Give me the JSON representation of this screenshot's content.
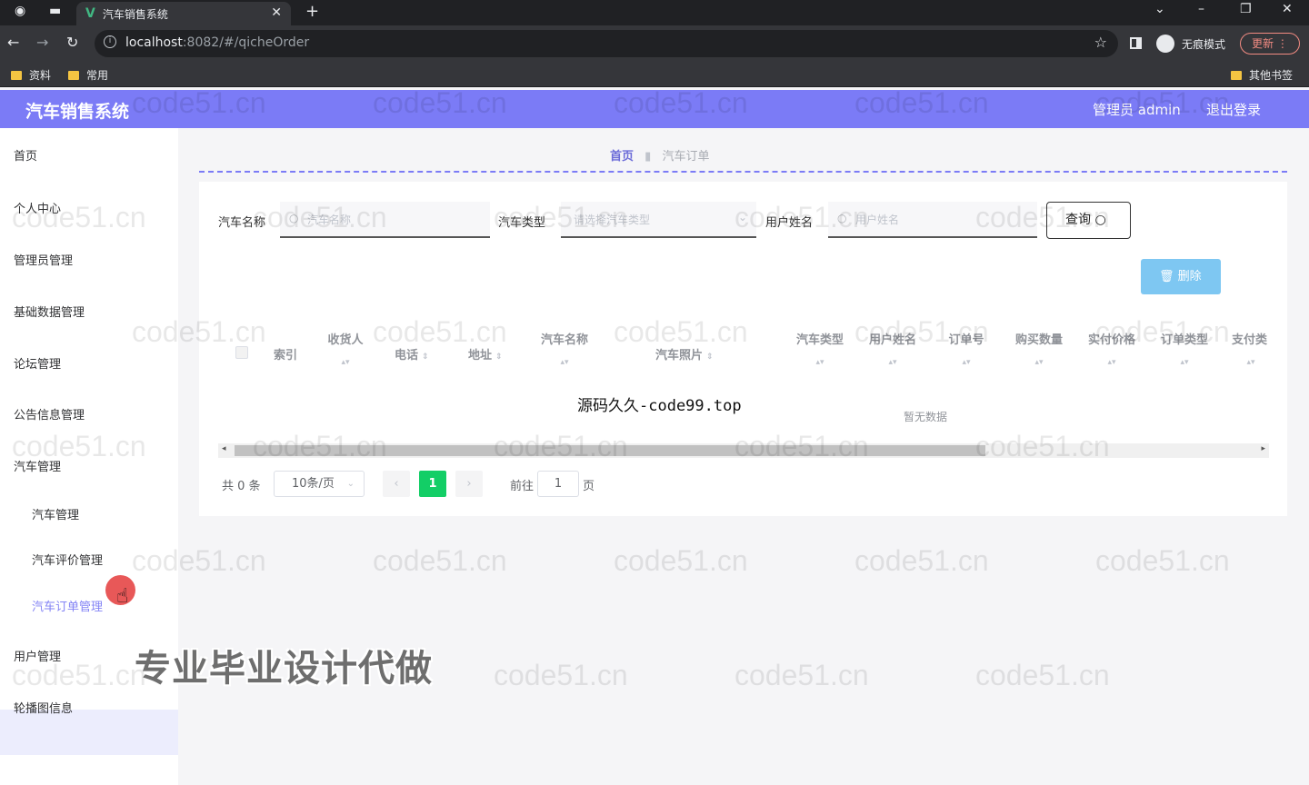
{
  "browser": {
    "tab_title": "汽车销售系统",
    "url_host": "localhost",
    "url_rest": ":8082/#/qicheOrder",
    "incognito_label": "无痕模式",
    "update_label": "更新",
    "bookmarks": [
      "资料",
      "常用"
    ],
    "other_bookmarks": "其他书签"
  },
  "header": {
    "title": "汽车销售系统",
    "admin_label": "管理员 admin",
    "logout_label": "退出登录"
  },
  "sidebar": {
    "items": [
      "首页",
      "个人中心",
      "管理员管理",
      "基础数据管理",
      "论坛管理",
      "公告信息管理",
      "汽车管理"
    ],
    "sub_items": [
      "汽车管理",
      "汽车评价管理",
      "汽车订单管理"
    ],
    "after_items": [
      "用户管理",
      "轮播图信息"
    ]
  },
  "breadcrumb": {
    "home": "首页",
    "current": "汽车订单"
  },
  "search": {
    "car_name_label": "汽车名称",
    "car_name_placeholder": "汽车名称",
    "car_type_label": "汽车类型",
    "car_type_placeholder": "请选择汽车类型",
    "user_name_label": "用户姓名",
    "user_name_placeholder": "用户姓名",
    "query_label": "查询"
  },
  "actions": {
    "delete_label": "删除"
  },
  "table": {
    "columns": {
      "index": "索引",
      "receiver": "收货人",
      "phone": "电话",
      "address": "地址",
      "car_name": "汽车名称",
      "car_photo": "汽车照片",
      "car_type": "汽车类型",
      "user_name": "用户姓名",
      "order_no": "订单号",
      "quantity": "购买数量",
      "price": "实付价格",
      "order_type": "订单类型",
      "pay_type": "支付类"
    },
    "empty_text": "暂无数据"
  },
  "pagination": {
    "total": "共 0 条",
    "page_size": "10条/页",
    "current_page": "1",
    "jump_label": "前往",
    "jump_value": "1",
    "page_suffix": "页"
  },
  "overlay": {
    "source_text": "源码久久-code99.top",
    "promo_text": "专业毕业设计代做",
    "watermark": "code51.cn"
  },
  "colors": {
    "header_bg": "#7b7bf6",
    "accent": "#8383f5",
    "page_active": "#13ce66",
    "delete_btn": "#7ec7f2"
  }
}
